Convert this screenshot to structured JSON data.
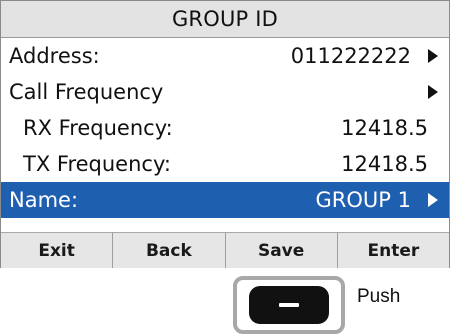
{
  "screen": {
    "title": "GROUP ID",
    "rows": [
      {
        "label": "Address:",
        "value": "011222222",
        "has_arrow": true,
        "selected": false
      },
      {
        "label": "Call Frequency",
        "value": "",
        "has_arrow": true,
        "selected": false
      },
      {
        "label": "RX Frequency:",
        "value": "12418.5",
        "has_arrow": false,
        "selected": false
      },
      {
        "label": "TX Frequency:",
        "value": "12418.5",
        "has_arrow": false,
        "selected": false
      },
      {
        "label": "Name:",
        "value": "GROUP 1",
        "has_arrow": true,
        "selected": true
      }
    ],
    "softkeys": [
      "Exit",
      "Back",
      "Save",
      "Enter"
    ]
  },
  "hardware": {
    "button_icon": "minus-icon",
    "push_label": "Push"
  },
  "colors": {
    "selection": "#1f5fb0",
    "title_bar": "#e3e3e3",
    "softkey_bar": "#e6e6e6"
  }
}
